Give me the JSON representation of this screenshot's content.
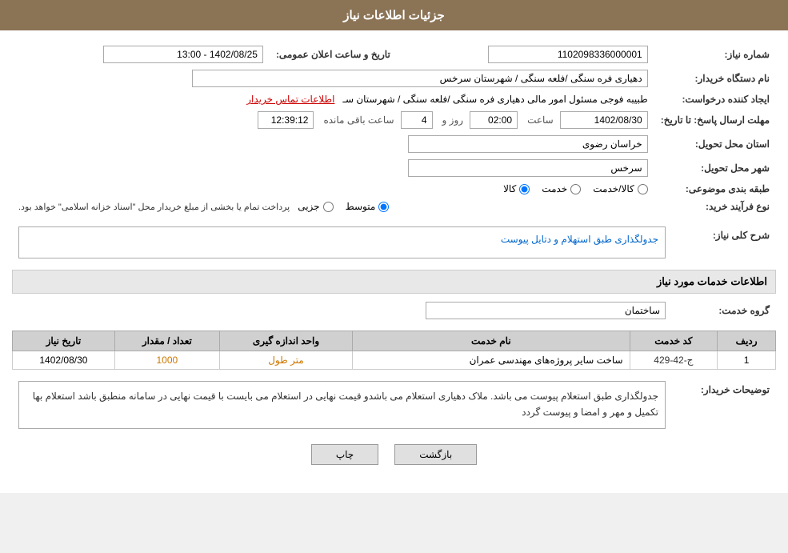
{
  "header": {
    "title": "جزئیات اطلاعات نیاز"
  },
  "info": {
    "need_number_label": "شماره نیاز:",
    "need_number_value": "1102098336000001",
    "buyer_org_label": "نام دستگاه خریدار:",
    "buyer_org_value": "دهیاری فره سنگی /فلعه سنگی / شهرستان سرخس",
    "announce_date_label": "تاریخ و ساعت اعلان عمومی:",
    "announce_date_value": "1402/08/25 - 13:00",
    "creator_label": "ایجاد کننده درخواست:",
    "creator_value": "طبیبه فوجی مسئول امور مالی دهیاری فره سنگی /فلعه سنگی / شهرستان سـ",
    "contact_link": "اطلاعات تماس خریدار",
    "reply_deadline_label": "مهلت ارسال پاسخ: تا تاریخ:",
    "reply_date": "1402/08/30",
    "reply_time_label": "ساعت",
    "reply_time": "02:00",
    "reply_days_label": "روز و",
    "reply_days": "4",
    "reply_remaining_label": "ساعت باقی مانده",
    "reply_remaining": "12:39:12",
    "delivery_province_label": "استان محل تحویل:",
    "delivery_province": "خراسان رضوی",
    "delivery_city_label": "شهر محل تحویل:",
    "delivery_city": "سرخس",
    "subject_type_label": "طبقه بندی موضوعی:",
    "subject_options": [
      "کالا",
      "خدمت",
      "کالا/خدمت"
    ],
    "subject_selected": "کالا",
    "purchase_type_label": "نوع فرآیند خرید:",
    "purchase_options": [
      "جزیی",
      "متوسط"
    ],
    "purchase_selected": "متوسط",
    "purchase_note": "پرداخت تمام یا بخشی از مبلغ خریدار محل \"اسناد خزانه اسلامی\" خواهد بود.",
    "need_description_label": "شرح کلی نیاز:",
    "need_description": "جدولگذاری طبق استهلام و دتایل پیوست"
  },
  "services_section": {
    "title": "اطلاعات خدمات مورد نیاز",
    "group_label": "گروه خدمت:",
    "group_value": "ساختمان",
    "table_headers": {
      "row_num": "ردیف",
      "code": "کد خدمت",
      "name": "نام خدمت",
      "unit": "واحد اندازه گیری",
      "qty": "تعداد / مقدار",
      "date": "تاریخ نیاز"
    },
    "rows": [
      {
        "num": "1",
        "code": "ج-42-429",
        "name": "ساخت سایر پروژه‌های مهندسی عمران",
        "unit": "متر طول",
        "qty": "1000",
        "date": "1402/08/30"
      }
    ]
  },
  "buyer_description_label": "توضیحات خریدار:",
  "buyer_description": "جدولگذاری طبق استعلام  پیوست می باشد. ملاک  دهیاری استعلام  می باشدو قیمت نهایی در استعلام می بایست با قیمت  نهایی در سامانه  منطبق باشد استعلام  بها  تکمیل  و مهر و امضا و پیوست  گردد",
  "buttons": {
    "back_label": "بازگشت",
    "print_label": "چاپ"
  }
}
